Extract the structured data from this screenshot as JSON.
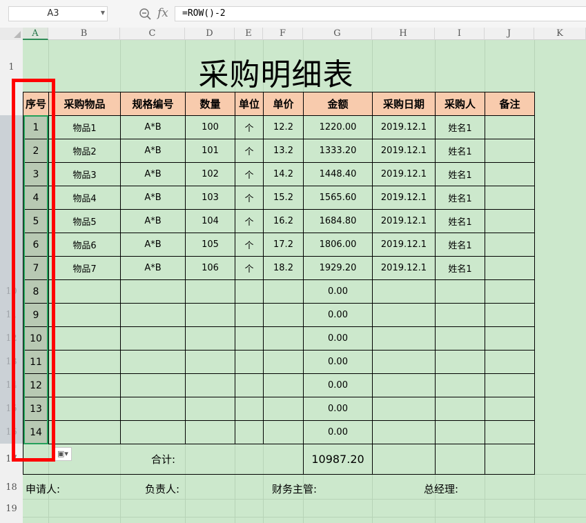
{
  "formula_bar": {
    "name_box": "A3",
    "fx_label": "fx",
    "formula": "=ROW()-2"
  },
  "column_headers": [
    "A",
    "B",
    "C",
    "D",
    "E",
    "F",
    "G",
    "H",
    "I",
    "J",
    "K"
  ],
  "row_headers": [
    "1",
    "",
    "",
    "",
    "",
    "",
    "",
    "",
    "",
    "10",
    "11",
    "12",
    "13",
    "14",
    "15",
    "16",
    "17",
    "18",
    "19"
  ],
  "sheet": {
    "title": "采购明细表",
    "headers": [
      "序号",
      "采购物品",
      "规格编号",
      "数量",
      "单位",
      "单价",
      "金额",
      "采购日期",
      "采购人",
      "备注"
    ],
    "rows": [
      [
        "1",
        "物品1",
        "A*B",
        "100",
        "个",
        "12.2",
        "1220.00",
        "2019.12.1",
        "姓名1",
        ""
      ],
      [
        "2",
        "物品2",
        "A*B",
        "101",
        "个",
        "13.2",
        "1333.20",
        "2019.12.1",
        "姓名1",
        ""
      ],
      [
        "3",
        "物品3",
        "A*B",
        "102",
        "个",
        "14.2",
        "1448.40",
        "2019.12.1",
        "姓名1",
        ""
      ],
      [
        "4",
        "物品4",
        "A*B",
        "103",
        "个",
        "15.2",
        "1565.60",
        "2019.12.1",
        "姓名1",
        ""
      ],
      [
        "5",
        "物品5",
        "A*B",
        "104",
        "个",
        "16.2",
        "1684.80",
        "2019.12.1",
        "姓名1",
        ""
      ],
      [
        "6",
        "物品6",
        "A*B",
        "105",
        "个",
        "17.2",
        "1806.00",
        "2019.12.1",
        "姓名1",
        ""
      ],
      [
        "7",
        "物品7",
        "A*B",
        "106",
        "个",
        "18.2",
        "1929.20",
        "2019.12.1",
        "姓名1",
        ""
      ],
      [
        "8",
        "",
        "",
        "",
        "",
        "",
        "0.00",
        "",
        "",
        ""
      ],
      [
        "9",
        "",
        "",
        "",
        "",
        "",
        "0.00",
        "",
        "",
        ""
      ],
      [
        "10",
        "",
        "",
        "",
        "",
        "",
        "0.00",
        "",
        "",
        ""
      ],
      [
        "11",
        "",
        "",
        "",
        "",
        "",
        "0.00",
        "",
        "",
        ""
      ],
      [
        "12",
        "",
        "",
        "",
        "",
        "",
        "0.00",
        "",
        "",
        ""
      ],
      [
        "13",
        "",
        "",
        "",
        "",
        "",
        "0.00",
        "",
        "",
        ""
      ],
      [
        "14",
        "",
        "",
        "",
        "",
        "",
        "0.00",
        "",
        "",
        ""
      ]
    ],
    "total_label": "合计:",
    "total_value": "10987.20",
    "footer": {
      "applicant": "申请人:",
      "manager": "负责人:",
      "finance": "财务主管:",
      "gm": "总经理:"
    }
  },
  "colors": {
    "sheet_bg": "#cce8cc",
    "header_bg": "#f8cbad",
    "highlight_frame": "#ff0000",
    "selection": "#24a05a"
  }
}
